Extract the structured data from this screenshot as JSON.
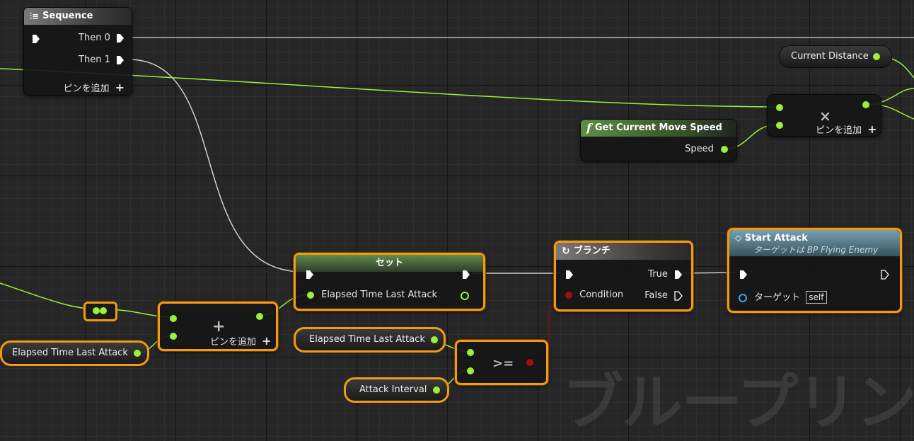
{
  "watermark": "ブループリント",
  "colors": {
    "float_wire": "#9af03a",
    "exec_wire": "#cfcfcf",
    "selection": "#f29a16",
    "bool_pin": "#a01010",
    "object_pin": "#3aa6ff"
  },
  "nodes": {
    "sequence": {
      "title": "Sequence",
      "icon": "sequence-icon",
      "out0": "Then 0",
      "out1": "Then 1",
      "add_pin": "ピンを追加"
    },
    "current_distance": {
      "label": "Current Distance"
    },
    "multiply": {
      "symbol": "×",
      "add_pin": "ピンを追加"
    },
    "get_speed": {
      "title": "Get Current Move Speed",
      "icon": "function-icon",
      "out": "Speed"
    },
    "set": {
      "title": "セット",
      "pin": "Elapsed Time Last Attack"
    },
    "branch": {
      "title": "ブランチ",
      "icon": "branch-icon",
      "true_label": "True",
      "condition": "Condition",
      "false_label": "False"
    },
    "start_attack": {
      "title": "Start Attack",
      "subtitle": "ターゲットは BP Flying Enemy",
      "target": "ターゲット",
      "target_value": "self"
    },
    "add": {
      "symbol": "+",
      "add_pin": "ピンを追加"
    },
    "elapsed_left": {
      "label": "Elapsed Time Last Attack"
    },
    "elapsed_mid": {
      "label": "Elapsed Time Last Attack"
    },
    "attack_interval": {
      "label": "Attack Interval"
    },
    "compare": {
      "symbol": ">="
    }
  }
}
